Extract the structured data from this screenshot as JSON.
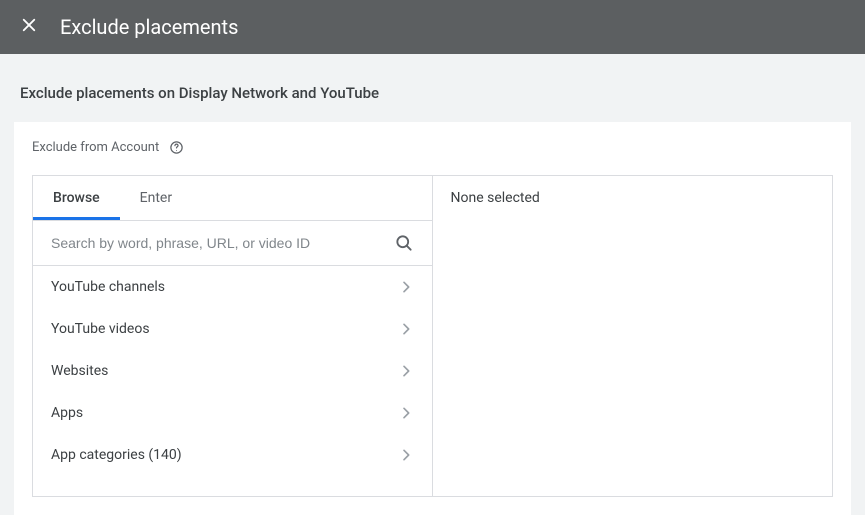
{
  "header": {
    "title": "Exclude placements"
  },
  "section_heading": "Exclude placements on Display Network and YouTube",
  "exclude_from_label": "Exclude from Account",
  "tabs": {
    "browse": "Browse",
    "enter": "Enter"
  },
  "search": {
    "placeholder": "Search by word, phrase, URL, or video ID"
  },
  "categories": [
    {
      "label": "YouTube channels"
    },
    {
      "label": "YouTube videos"
    },
    {
      "label": "Websites"
    },
    {
      "label": "Apps"
    },
    {
      "label": "App categories (140)"
    }
  ],
  "right_pane": {
    "status": "None selected"
  }
}
